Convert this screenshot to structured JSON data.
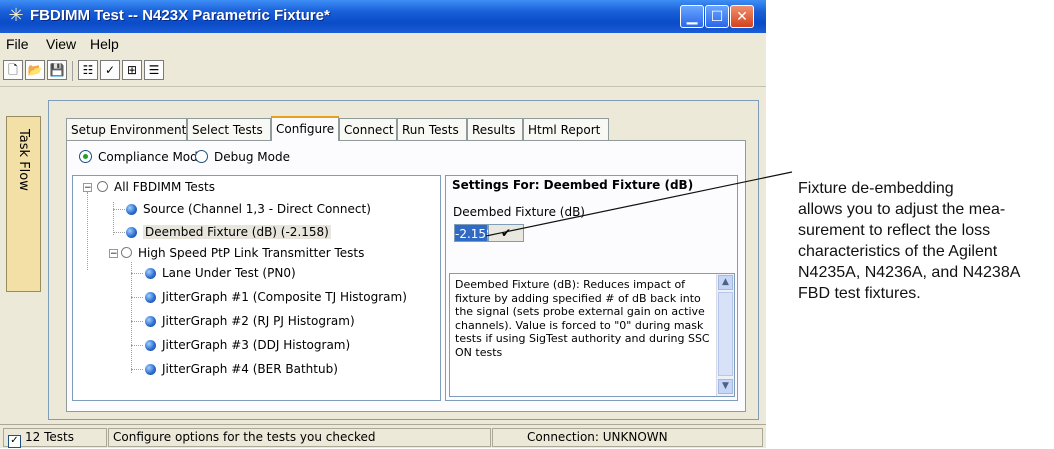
{
  "window": {
    "title": "FBDIMM Test -- N423X Parametric Fixture*",
    "app_icon": "sparkle-icon"
  },
  "menu": [
    "File",
    "View",
    "Help"
  ],
  "toolbar": {
    "icons": [
      "new-icon",
      "open-icon",
      "save-icon",
      "properties-icon",
      "checklist-icon",
      "tree-view-icon",
      "list-view-icon"
    ]
  },
  "task_flow_label": "Task Flow",
  "tabs": [
    {
      "label": "Setup Environment",
      "active": false
    },
    {
      "label": "Select Tests",
      "active": false
    },
    {
      "label": "Configure",
      "active": true
    },
    {
      "label": "Connect",
      "active": false
    },
    {
      "label": "Run Tests",
      "active": false
    },
    {
      "label": "Results",
      "active": false
    },
    {
      "label": "Html Report",
      "active": false
    }
  ],
  "mode": {
    "compliance_label": "Compliance Mode",
    "debug_label": "Debug Mode",
    "selected": "Compliance Mode"
  },
  "tree": {
    "root": "All FBDIMM Tests",
    "items": [
      {
        "label": "Source (Channel 1,3 - Direct Connect)"
      },
      {
        "label": "Deembed Fixture (dB) (-2.158)"
      },
      {
        "label": "High Speed PtP Link Transmitter Tests"
      },
      {
        "label": "Lane Under Test (PN0)"
      },
      {
        "label": "JitterGraph #1 (Composite TJ Histogram)"
      },
      {
        "label": "JitterGraph #2 (RJ PJ Histogram)"
      },
      {
        "label": "JitterGraph #3 (DDJ Histogram)"
      },
      {
        "label": "JitterGraph #4 (BER Bathtub)"
      }
    ]
  },
  "settings": {
    "title": "Settings For: Deembed Fixture (dB)",
    "field_label": "Deembed Fixture (dB)",
    "value": "-2.158",
    "description": "Deembed Fixture (dB): Reduces impact of fixture by adding specified # of dB back into the signal (sets probe external gain on active channels). Value is forced to \"0\" during mask tests if using SigTest authority and during SSC ON tests"
  },
  "status": {
    "tests_count": "12 Tests",
    "message": "Configure options for the tests you checked",
    "connection": "Connection: UNKNOWN"
  },
  "callout": {
    "lines": [
      "Fixture de-embedding",
      "allows you to adjust the mea-",
      "surement to reflect the loss",
      "characteristics of the Agilent",
      "N4235A, N4236A, and N4238A",
      "FBD test fixtures."
    ]
  }
}
